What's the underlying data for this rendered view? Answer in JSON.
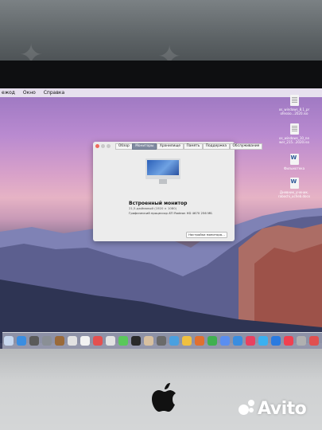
{
  "menubar": {
    "items": [
      "ежод",
      "Окно",
      "Справка"
    ]
  },
  "window": {
    "tabs": [
      "Обзор",
      "Мониторы",
      "Хранилище",
      "Память",
      "Поддержка",
      "Обслуживание"
    ],
    "active_tab_index": 1,
    "monitor_name": "Встроенный монитор",
    "monitor_resolution": "21,5-дюймовый (1920 × 1080)",
    "monitor_gpu": "Графический процессор ATI Radeon HD 4670 256 МБ",
    "settings_button": "Настройки монитора…"
  },
  "desktop_icons": [
    "os_windows_8.1_pr ofessio...2020.iso",
    "os_windows_10_ne wer_215...2020.iso",
    "Фильмотека",
    "Дневник_ученик. rabochi_ucheb.docx"
  ],
  "dock": {
    "icon_colors": [
      "#c7d7ee",
      "#3a8de0",
      "#5a5a5a",
      "#8a8f95",
      "#9a6a3a",
      "#e2e2e2",
      "#f2f2f2",
      "#e45050",
      "#e2e2e2",
      "#5ac85a",
      "#2a2a2a",
      "#d8c0a0",
      "#6a6a6a",
      "#4aa0e0",
      "#f0c040",
      "#e07030",
      "#40b050",
      "#5a8ef0",
      "#3a8de0",
      "#e84060",
      "#3ab0f0",
      "#2a7ae0",
      "#f04050",
      "#b0b0b0",
      "#e05050",
      "#3a3a3a",
      "#3a6ef0",
      "#5ac85a",
      "#2a2a2a",
      "#8a6ae0"
    ]
  },
  "watermark": {
    "text": "Avito"
  }
}
